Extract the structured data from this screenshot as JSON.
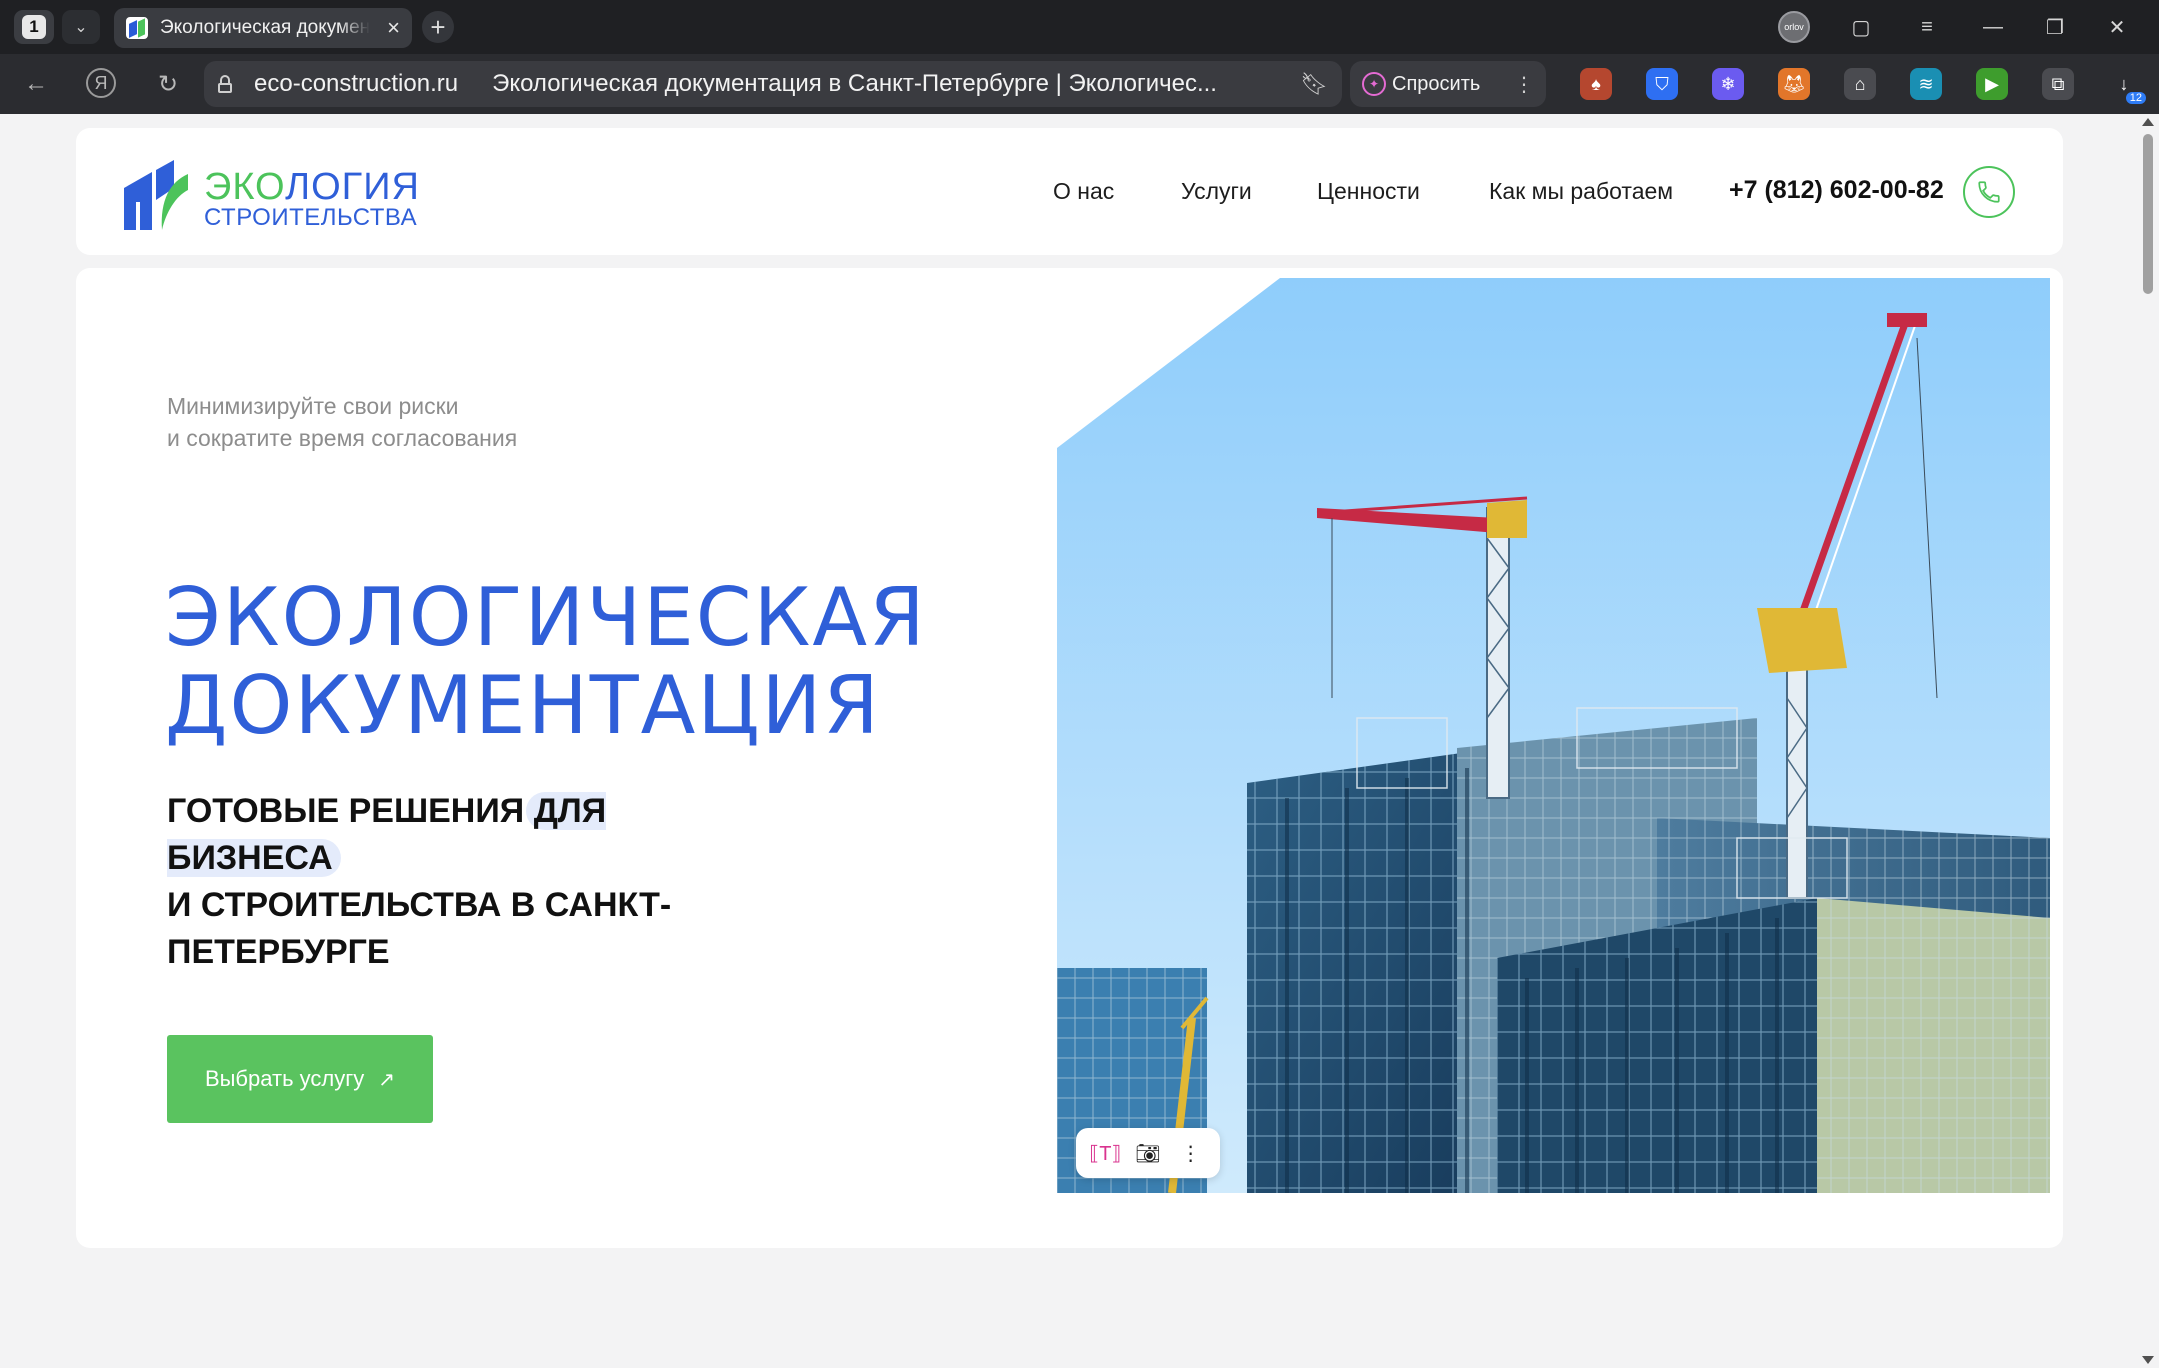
{
  "browser": {
    "tab_count": "1",
    "tab_title": "Экологическая документация в Санкт-Петербурге | Экологическ...",
    "url_domain": "eco-construction.ru",
    "url_title": "Экологическая документация в Санкт-Петербурге | Экологичес...",
    "ask_label": "Спросить",
    "profile_label": "orlov",
    "extension_badge": "12"
  },
  "site": {
    "logo_line1_a": "ЭКО",
    "logo_line1_b": "ЛОГИЯ",
    "logo_line2": "СТРОИТЕЛЬСТВА",
    "nav": [
      "О нас",
      "Услуги",
      "Ценности",
      "Как мы работаем"
    ],
    "phone": "+7 (812) 602-00-82"
  },
  "hero": {
    "subtitle_line1": "Минимизируйте свои риски",
    "subtitle_line2": "и сократите время согласования",
    "title_line1": "ЭКОЛОГИЧЕСКАЯ",
    "title_line2": "ДОКУМЕНТАЦИЯ",
    "lead_part1": "Готовые решения ",
    "lead_highlight": "для бизнеса",
    "lead_part2": "и строительства в Санкт-Петербурге",
    "cta_label": "Выбрать услугу",
    "cta_arrow": "↗"
  },
  "colors": {
    "brand_blue": "#2f5fd8",
    "brand_green": "#4cc35b",
    "cta_green": "#5ac35f"
  }
}
